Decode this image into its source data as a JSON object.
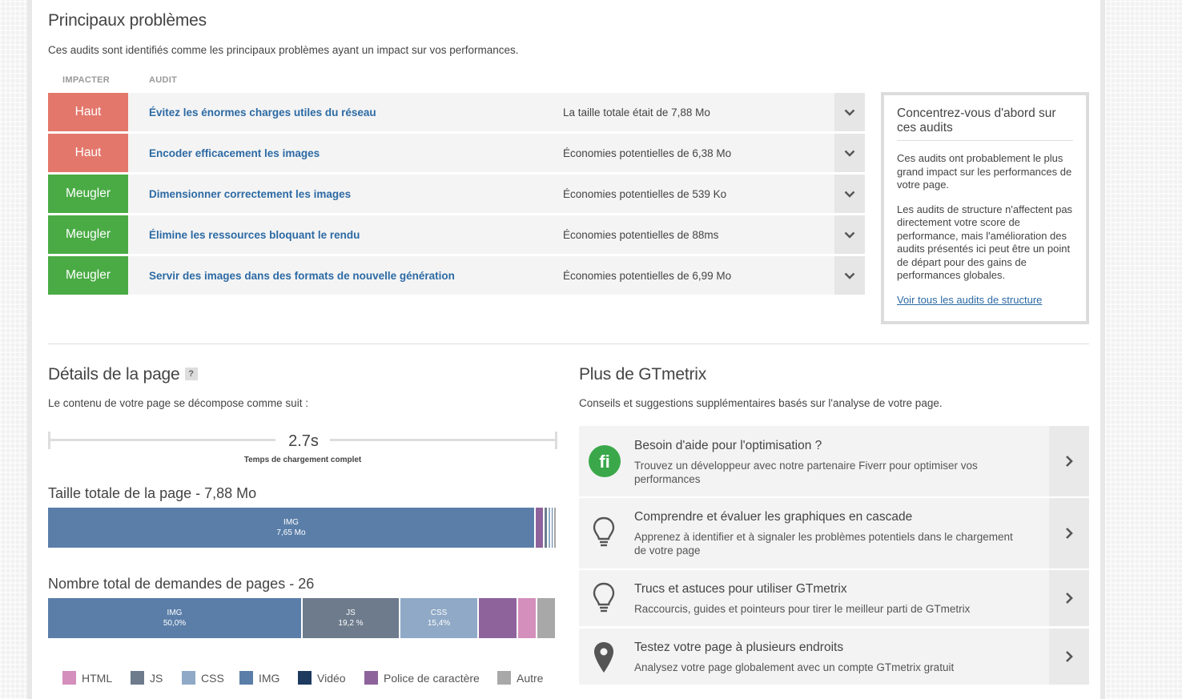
{
  "top_issues": {
    "title": "Principaux problèmes",
    "intro": "Ces audits sont identifiés comme les principaux problèmes ayant un impact sur vos performances.",
    "col_impact": "IMPACTER",
    "col_audit": "AUDIT",
    "rows": [
      {
        "impact": "Haut",
        "level": "high",
        "title": "Évitez les énormes charges utiles du réseau",
        "summary": "La taille totale était de 7,88 Mo"
      },
      {
        "impact": "Haut",
        "level": "high",
        "title": "Encoder efficacement les images",
        "summary": "Économies potentielles de 6,38 Mo"
      },
      {
        "impact": "Meugler",
        "level": "low",
        "title": "Dimensionner correctement les images",
        "summary": "Économies potentielles de 539 Ko"
      },
      {
        "impact": "Meugler",
        "level": "low",
        "title": "Élimine les ressources bloquant le rendu",
        "summary": "Économies potentielles de 88ms"
      },
      {
        "impact": "Meugler",
        "level": "low",
        "title": "Servir des images dans des formats de nouvelle génération",
        "summary": "Économies potentielles de 6,99 Mo"
      }
    ]
  },
  "focus_box": {
    "title": "Concentrez-vous d'abord sur ces audits",
    "p1": "Ces audits ont probablement le plus grand impact sur les performances de votre page.",
    "p2": "Les audits de structure n'affectent pas directement votre score de performance, mais l'amélioration des audits présentés ici peut être un point de départ pour des gains de performances globales.",
    "link": "Voir tous les audits de structure"
  },
  "page_details": {
    "title": "Détails de la page",
    "help": "?",
    "intro": "Le contenu de votre page se décompose comme suit :",
    "load_time": "2.7s",
    "load_label": "Temps de chargement complet",
    "size_title": "Taille totale de la page - 7,88 Mo",
    "size_bar": [
      {
        "type": "IMG",
        "label": "IMG",
        "value": "7,65 Mo",
        "fraction": 0.958
      },
      {
        "type": "Police",
        "label": "",
        "value": "",
        "fraction": 0.017
      },
      {
        "type": "JS",
        "label": "",
        "value": "",
        "fraction": 0.008
      },
      {
        "type": "CSS",
        "label": "",
        "value": "",
        "fraction": 0.006
      },
      {
        "type": "IMG2",
        "label": "",
        "value": "",
        "fraction": 0.004
      },
      {
        "type": "Autre",
        "label": "",
        "value": "",
        "fraction": 0.007
      }
    ],
    "requests_title": "Nombre total de demandes de pages - 26",
    "requests_bar": [
      {
        "type": "IMG",
        "label": "IMG",
        "value": "50,0%",
        "fraction": 0.5
      },
      {
        "type": "JS",
        "label": "JS",
        "value": "19,2 %",
        "fraction": 0.192
      },
      {
        "type": "CSS",
        "label": "CSS",
        "value": "15,4%",
        "fraction": 0.154
      },
      {
        "type": "Police",
        "label": "",
        "value": "",
        "fraction": 0.077
      },
      {
        "type": "HTML",
        "label": "",
        "value": "",
        "fraction": 0.038
      },
      {
        "type": "Autre",
        "label": "",
        "value": "",
        "fraction": 0.038
      }
    ],
    "legend": [
      {
        "label": "HTML",
        "color": "#d48fbc"
      },
      {
        "label": "JS",
        "color": "#6d7b8c"
      },
      {
        "label": "CSS",
        "color": "#8fa9c6"
      },
      {
        "label": "IMG",
        "color": "#5a7ea8"
      },
      {
        "label": "Vidéo",
        "color": "#1e3a5f"
      },
      {
        "label": "Police de caractère",
        "color": "#8e639c"
      },
      {
        "label": "Autre",
        "color": "#a8a8a8"
      }
    ]
  },
  "more": {
    "title": "Plus de GTmetrix",
    "intro": "Conseils et suggestions supplémentaires basés sur l'analyse de votre page.",
    "items": [
      {
        "icon": "fiverr-icon",
        "title": "Besoin d'aide pour l'optimisation ?",
        "desc": "Trouvez un développeur avec notre partenaire Fiverr pour optimiser vos performances"
      },
      {
        "icon": "lightbulb-icon",
        "title": "Comprendre et évaluer les graphiques en cascade",
        "desc": "Apprenez à identifier et à signaler les problèmes potentiels dans le chargement de votre page"
      },
      {
        "icon": "lightbulb-icon",
        "title": "Trucs et astuces pour utiliser GTmetrix",
        "desc": "Raccourcis, guides et pointeurs pour tirer le meilleur parti de GTmetrix"
      },
      {
        "icon": "map-pin-icon",
        "title": "Testez votre page à plusieurs endroits",
        "desc": "Analysez votre page globalement avec un compte GTmetrix gratuit"
      }
    ]
  },
  "colors": {
    "high": "#e3776b",
    "low": "#4aab45",
    "link": "#2c6aa4",
    "fiverr": "#3aa84a"
  }
}
